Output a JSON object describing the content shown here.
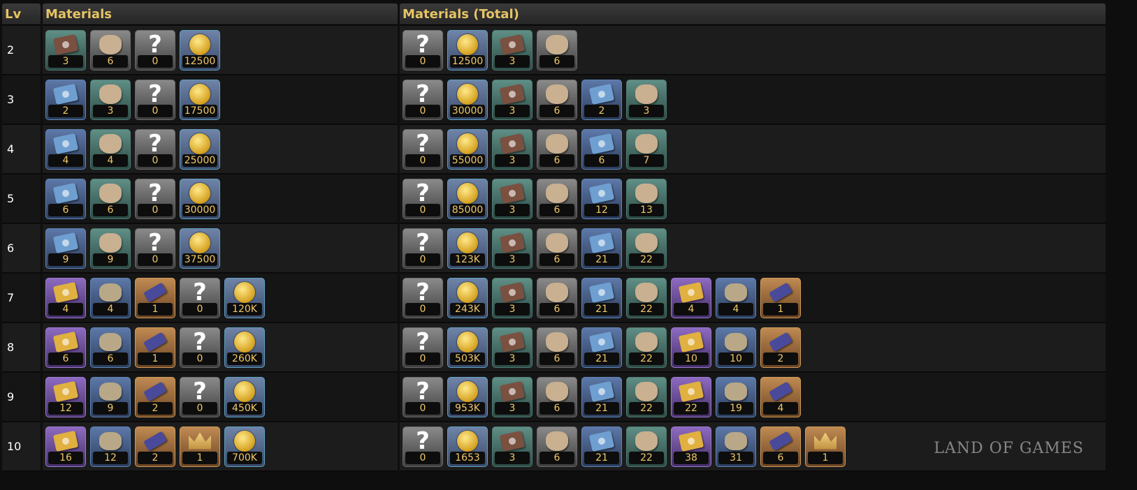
{
  "headers": {
    "lv": "Lv",
    "materials": "Materials",
    "total": "Materials (Total)"
  },
  "watermark": "LAND OF GAMES",
  "rows": [
    {
      "lv": "2",
      "materials": [
        [
          "book-brown-icon",
          "green",
          "3"
        ],
        [
          "cat-gray-icon",
          "gray",
          "6"
        ],
        [
          "question-icon",
          "gray",
          "0"
        ],
        [
          "mora-coin-icon",
          "mora",
          "12500"
        ]
      ],
      "total": [
        [
          "question-icon",
          "gray",
          "0"
        ],
        [
          "mora-coin-icon",
          "mora",
          "12500"
        ],
        [
          "book-brown-icon",
          "green",
          "3"
        ],
        [
          "cat-gray-icon",
          "gray",
          "6"
        ]
      ]
    },
    {
      "lv": "3",
      "materials": [
        [
          "book-blue-icon",
          "blue",
          "2"
        ],
        [
          "cat-green-icon",
          "green",
          "3"
        ],
        [
          "question-icon",
          "gray",
          "0"
        ],
        [
          "mora-coin-icon",
          "mora",
          "17500"
        ]
      ],
      "total": [
        [
          "question-icon",
          "gray",
          "0"
        ],
        [
          "mora-coin-icon",
          "mora",
          "30000"
        ],
        [
          "book-brown-icon",
          "green",
          "3"
        ],
        [
          "cat-gray-icon",
          "gray",
          "6"
        ],
        [
          "book-blue-icon",
          "blue",
          "2"
        ],
        [
          "cat-green-icon",
          "green",
          "3"
        ]
      ]
    },
    {
      "lv": "4",
      "materials": [
        [
          "book-blue-icon",
          "blue",
          "4"
        ],
        [
          "cat-green-icon",
          "green",
          "4"
        ],
        [
          "question-icon",
          "gray",
          "0"
        ],
        [
          "mora-coin-icon",
          "mora",
          "25000"
        ]
      ],
      "total": [
        [
          "question-icon",
          "gray",
          "0"
        ],
        [
          "mora-coin-icon",
          "mora",
          "55000"
        ],
        [
          "book-brown-icon",
          "green",
          "3"
        ],
        [
          "cat-gray-icon",
          "gray",
          "6"
        ],
        [
          "book-blue-icon",
          "blue",
          "6"
        ],
        [
          "cat-green-icon",
          "green",
          "7"
        ]
      ]
    },
    {
      "lv": "5",
      "materials": [
        [
          "book-blue-icon",
          "blue",
          "6"
        ],
        [
          "cat-green-icon",
          "green",
          "6"
        ],
        [
          "question-icon",
          "gray",
          "0"
        ],
        [
          "mora-coin-icon",
          "mora",
          "30000"
        ]
      ],
      "total": [
        [
          "question-icon",
          "gray",
          "0"
        ],
        [
          "mora-coin-icon",
          "mora",
          "85000"
        ],
        [
          "book-brown-icon",
          "green",
          "3"
        ],
        [
          "cat-gray-icon",
          "gray",
          "6"
        ],
        [
          "book-blue-icon",
          "blue",
          "12"
        ],
        [
          "cat-green-icon",
          "green",
          "13"
        ]
      ]
    },
    {
      "lv": "6",
      "materials": [
        [
          "book-blue-icon",
          "blue",
          "9"
        ],
        [
          "cat-green-icon",
          "green",
          "9"
        ],
        [
          "question-icon",
          "gray",
          "0"
        ],
        [
          "mora-coin-icon",
          "mora",
          "37500"
        ]
      ],
      "total": [
        [
          "question-icon",
          "gray",
          "0"
        ],
        [
          "mora-coin-icon",
          "mora",
          "123K"
        ],
        [
          "book-brown-icon",
          "green",
          "3"
        ],
        [
          "cat-gray-icon",
          "gray",
          "6"
        ],
        [
          "book-blue-icon",
          "blue",
          "21"
        ],
        [
          "cat-green-icon",
          "green",
          "22"
        ]
      ]
    },
    {
      "lv": "7",
      "materials": [
        [
          "book-gold-icon",
          "purple",
          "4"
        ],
        [
          "mask-icon",
          "blue",
          "4"
        ],
        [
          "claw-icon",
          "orange",
          "1"
        ],
        [
          "question-icon",
          "gray",
          "0"
        ],
        [
          "mora-coin-icon",
          "mora",
          "120K"
        ]
      ],
      "total": [
        [
          "question-icon",
          "gray",
          "0"
        ],
        [
          "mora-coin-icon",
          "mora",
          "243K"
        ],
        [
          "book-brown-icon",
          "green",
          "3"
        ],
        [
          "cat-gray-icon",
          "gray",
          "6"
        ],
        [
          "book-blue-icon",
          "blue",
          "21"
        ],
        [
          "cat-green-icon",
          "green",
          "22"
        ],
        [
          "book-gold-icon",
          "purple",
          "4"
        ],
        [
          "mask-icon",
          "blue",
          "4"
        ],
        [
          "claw-icon",
          "orange",
          "1"
        ]
      ]
    },
    {
      "lv": "8",
      "materials": [
        [
          "book-gold-icon",
          "purple",
          "6"
        ],
        [
          "mask-icon",
          "blue",
          "6"
        ],
        [
          "claw-icon",
          "orange",
          "1"
        ],
        [
          "question-icon",
          "gray",
          "0"
        ],
        [
          "mora-coin-icon",
          "mora",
          "260K"
        ]
      ],
      "total": [
        [
          "question-icon",
          "gray",
          "0"
        ],
        [
          "mora-coin-icon",
          "mora",
          "503K"
        ],
        [
          "book-brown-icon",
          "green",
          "3"
        ],
        [
          "cat-gray-icon",
          "gray",
          "6"
        ],
        [
          "book-blue-icon",
          "blue",
          "21"
        ],
        [
          "cat-green-icon",
          "green",
          "22"
        ],
        [
          "book-gold-icon",
          "purple",
          "10"
        ],
        [
          "mask-icon",
          "blue",
          "10"
        ],
        [
          "claw-icon",
          "orange",
          "2"
        ]
      ]
    },
    {
      "lv": "9",
      "materials": [
        [
          "book-gold-icon",
          "purple",
          "12"
        ],
        [
          "mask-icon",
          "blue",
          "9"
        ],
        [
          "claw-icon",
          "orange",
          "2"
        ],
        [
          "question-icon",
          "gray",
          "0"
        ],
        [
          "mora-coin-icon",
          "mora",
          "450K"
        ]
      ],
      "total": [
        [
          "question-icon",
          "gray",
          "0"
        ],
        [
          "mora-coin-icon",
          "mora",
          "953K"
        ],
        [
          "book-brown-icon",
          "green",
          "3"
        ],
        [
          "cat-gray-icon",
          "gray",
          "6"
        ],
        [
          "book-blue-icon",
          "blue",
          "21"
        ],
        [
          "cat-green-icon",
          "green",
          "22"
        ],
        [
          "book-gold-icon",
          "purple",
          "22"
        ],
        [
          "mask-icon",
          "blue",
          "19"
        ],
        [
          "claw-icon",
          "orange",
          "4"
        ]
      ]
    },
    {
      "lv": "10",
      "materials": [
        [
          "book-gold-icon",
          "purple",
          "16"
        ],
        [
          "mask-icon",
          "blue",
          "12"
        ],
        [
          "claw-icon",
          "orange",
          "2"
        ],
        [
          "crown-icon",
          "orange",
          "1"
        ],
        [
          "mora-coin-icon",
          "mora",
          "700K"
        ]
      ],
      "total": [
        [
          "question-icon",
          "gray",
          "0"
        ],
        [
          "mora-coin-icon",
          "mora",
          "1653"
        ],
        [
          "book-brown-icon",
          "green",
          "3"
        ],
        [
          "cat-gray-icon",
          "gray",
          "6"
        ],
        [
          "book-blue-icon",
          "blue",
          "21"
        ],
        [
          "cat-green-icon",
          "green",
          "22"
        ],
        [
          "book-gold-icon",
          "purple",
          "38"
        ],
        [
          "mask-icon",
          "blue",
          "31"
        ],
        [
          "claw-icon",
          "orange",
          "6"
        ],
        [
          "crown-icon",
          "orange",
          "1"
        ]
      ]
    }
  ]
}
